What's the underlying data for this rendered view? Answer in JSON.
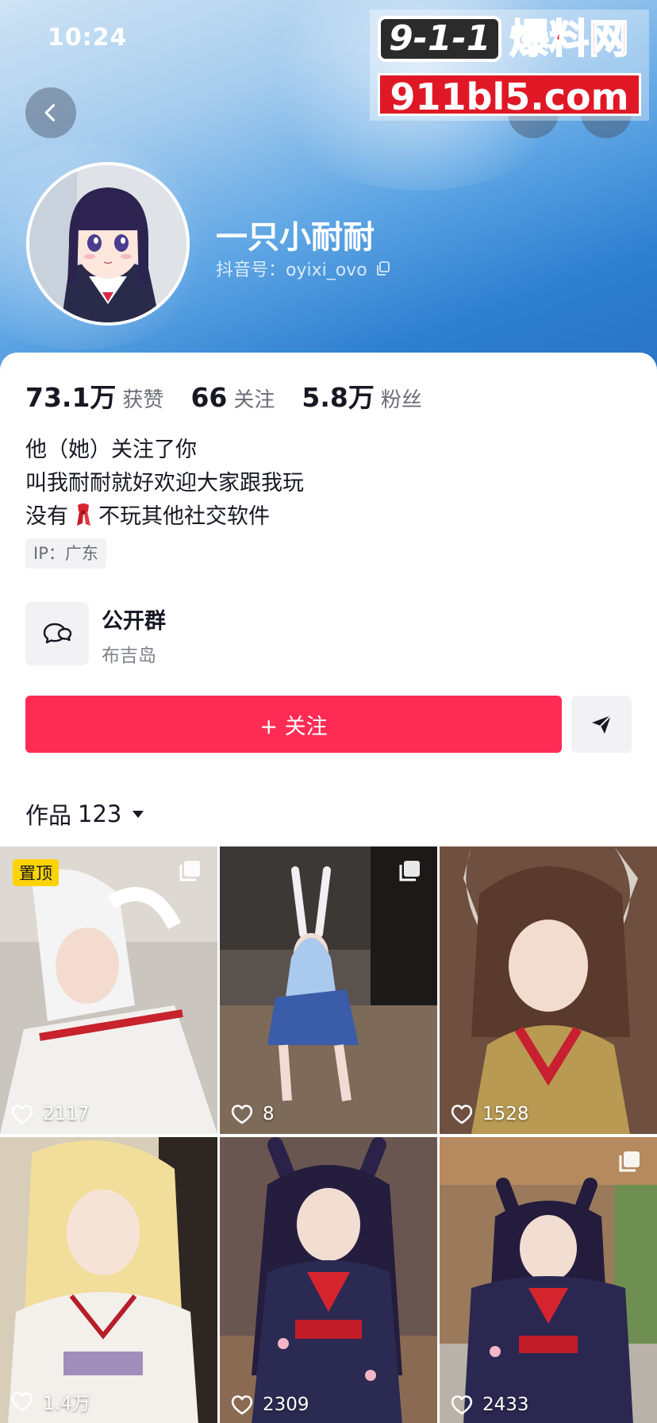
{
  "status_bar": {
    "time": "10:24"
  },
  "watermark": {
    "badge": "9-1-1",
    "title": "爆料网",
    "url": "911bl5.com"
  },
  "profile": {
    "name": "一只小耐耐",
    "douyin_id": "抖音号：oyixi_ovo"
  },
  "stats": [
    {
      "value": "73.1万",
      "label": "获赞"
    },
    {
      "value": "66",
      "label": "关注"
    },
    {
      "value": "5.8万",
      "label": "粉丝"
    }
  ],
  "bio": {
    "line1": "他（她）关注了你",
    "line2": "叫我耐耐就好欢迎大家跟我玩",
    "line3_before": "没有",
    "line3_after": "不玩其他社交软件"
  },
  "ip_tag": "IP：广东",
  "group": {
    "title": "公开群",
    "subtitle": "布吉岛"
  },
  "follow_button": "+ 关注",
  "works": {
    "label": "作品",
    "count": "123"
  },
  "pinned_label": "置顶",
  "videos": [
    {
      "likes": "2117",
      "pinned": true,
      "multi": true,
      "bg": "#c9c2bb"
    },
    {
      "likes": "8",
      "pinned": false,
      "multi": true,
      "bg": "#4b4541"
    },
    {
      "likes": "1528",
      "pinned": false,
      "multi": false,
      "bg": "#7a5444"
    },
    {
      "likes": "1.4万",
      "pinned": false,
      "multi": false,
      "bg": "#d8cfb9"
    },
    {
      "likes": "2309",
      "pinned": false,
      "multi": false,
      "bg": "#4a3838"
    },
    {
      "likes": "2433",
      "pinned": false,
      "multi": true,
      "bg": "#8b6a50"
    }
  ],
  "colors": {
    "accent": "#fe2c55",
    "pinned_badge": "#fcd307",
    "text": "#161823",
    "muted": "#6b6e77"
  }
}
